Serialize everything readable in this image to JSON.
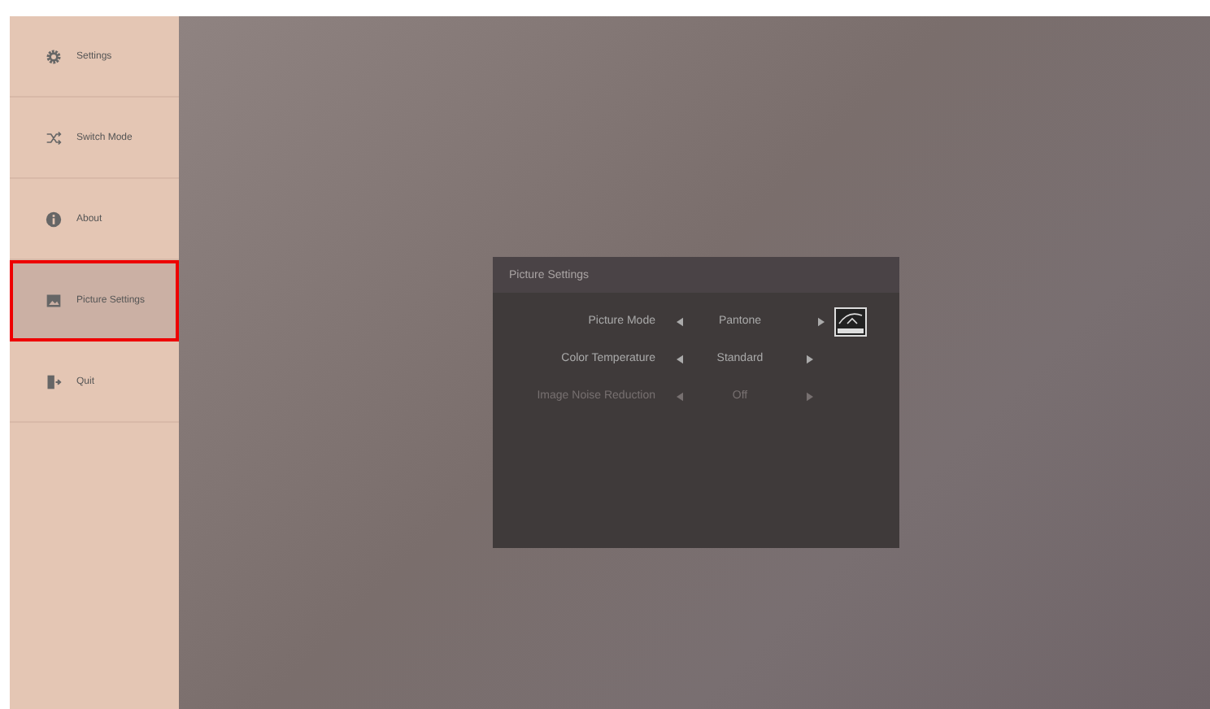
{
  "sidebar": {
    "items": [
      {
        "label": "Settings",
        "kind": "gear",
        "selected": false
      },
      {
        "label": "Switch Mode",
        "kind": "switch",
        "selected": false
      },
      {
        "label": "About",
        "kind": "info",
        "selected": false
      },
      {
        "label": "Picture Settings",
        "kind": "picture",
        "selected": true
      },
      {
        "label": "Quit",
        "kind": "exit",
        "selected": false
      }
    ]
  },
  "dialog": {
    "title": "Picture Settings",
    "rows": [
      {
        "label": "Picture Mode",
        "value": "Pantone",
        "disabled": false,
        "badge": true
      },
      {
        "label": "Color Temperature",
        "value": "Standard",
        "disabled": false,
        "badge": false
      },
      {
        "label": "Image Noise Reduction",
        "value": "Off",
        "disabled": true,
        "badge": false
      }
    ]
  }
}
